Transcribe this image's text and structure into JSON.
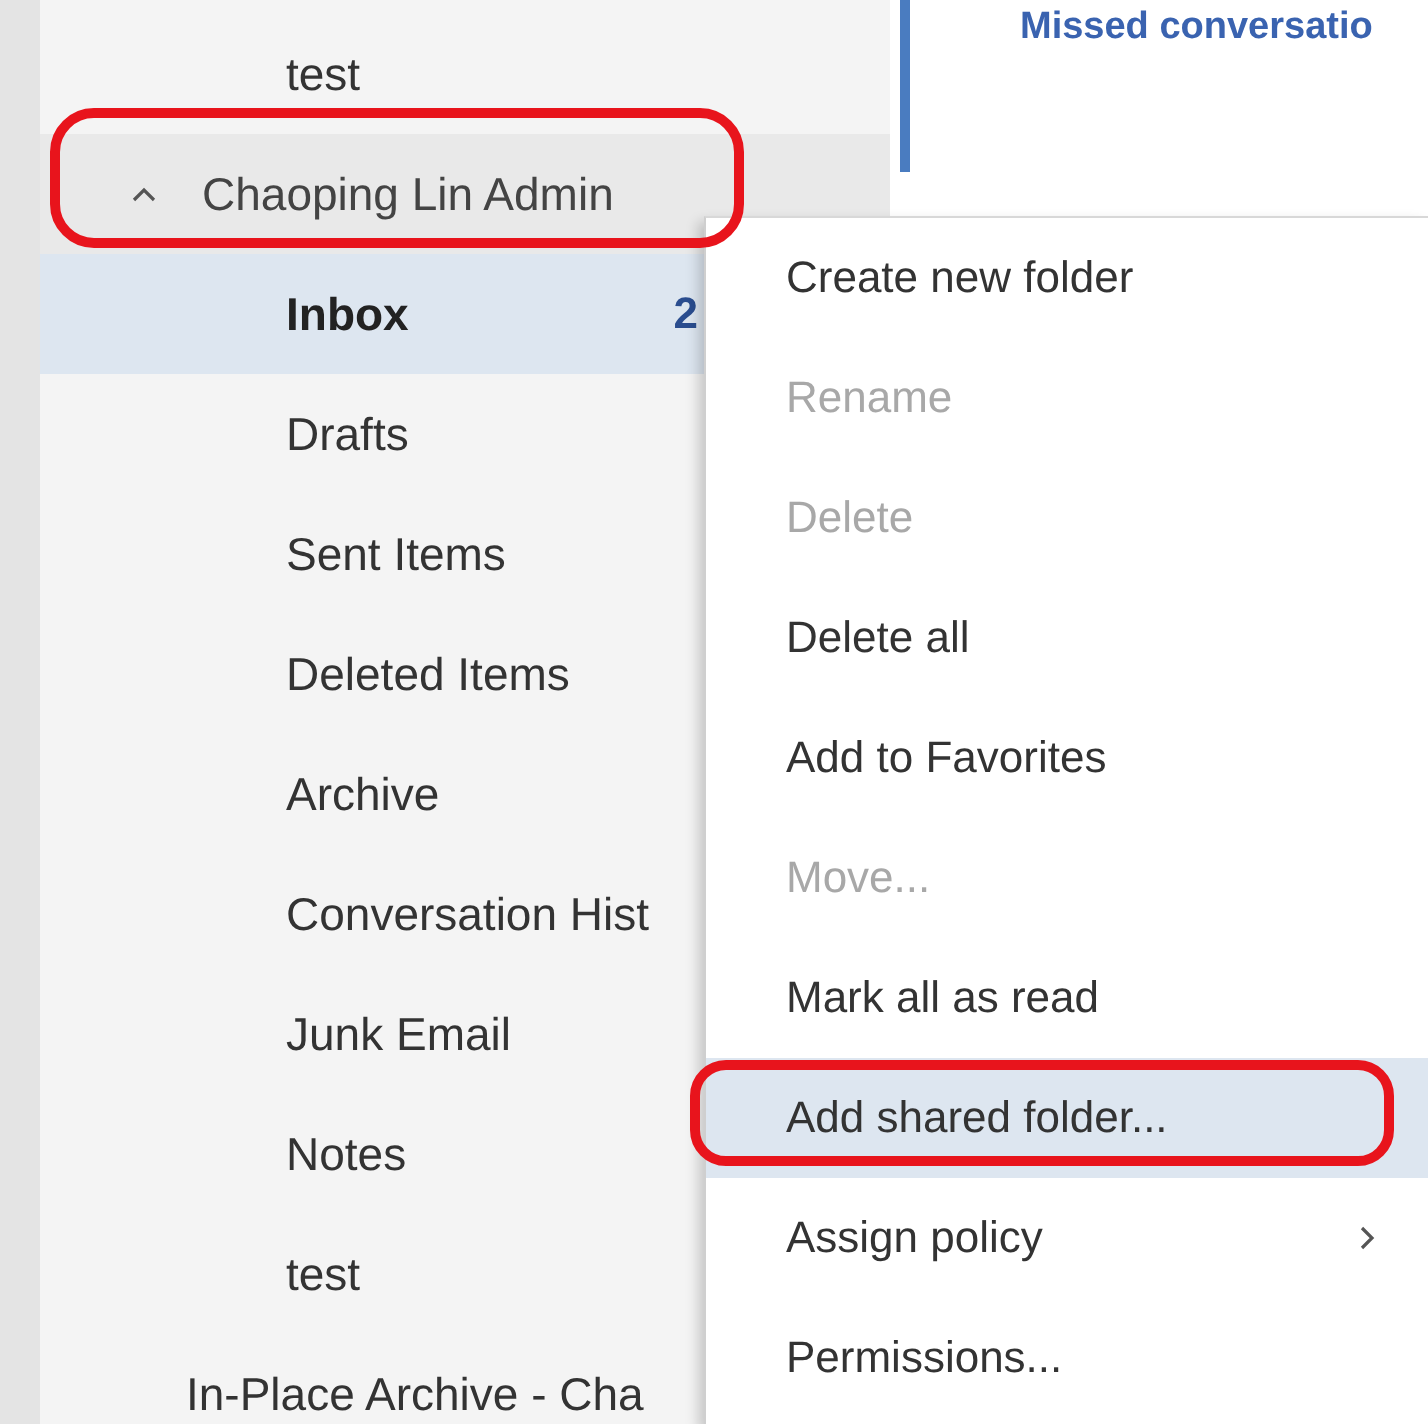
{
  "folders": [
    {
      "kind": "folder",
      "label": "test",
      "selected": false
    },
    {
      "kind": "account",
      "label": "Chaoping Lin Admin",
      "expanded": true,
      "annotated": true
    },
    {
      "kind": "folder",
      "label": "Inbox",
      "selected": true,
      "count": "2"
    },
    {
      "kind": "folder",
      "label": "Drafts",
      "selected": false
    },
    {
      "kind": "folder",
      "label": "Sent Items",
      "selected": false
    },
    {
      "kind": "folder",
      "label": "Deleted Items",
      "selected": false
    },
    {
      "kind": "folder",
      "label": "Archive",
      "selected": false
    },
    {
      "kind": "folder",
      "label": "Conversation Hist",
      "selected": false
    },
    {
      "kind": "folder",
      "label": "Junk Email",
      "selected": false
    },
    {
      "kind": "folder",
      "label": "Notes",
      "selected": false
    },
    {
      "kind": "folder",
      "label": "test",
      "selected": false
    },
    {
      "kind": "archive",
      "label": "In-Place Archive - Cha"
    }
  ],
  "message_preview": {
    "title": "Missed conversatio"
  },
  "context_menu": [
    {
      "label": "Create new folder",
      "disabled": false,
      "selected": false
    },
    {
      "label": "Rename",
      "disabled": true,
      "selected": false
    },
    {
      "label": "Delete",
      "disabled": true,
      "selected": false
    },
    {
      "label": "Delete all",
      "disabled": false,
      "selected": false
    },
    {
      "label": "Add to Favorites",
      "disabled": false,
      "selected": false
    },
    {
      "label": "Move...",
      "disabled": true,
      "selected": false
    },
    {
      "label": "Mark all as read",
      "disabled": false,
      "selected": false
    },
    {
      "label": "Add shared folder...",
      "disabled": false,
      "selected": true,
      "annotated": true
    },
    {
      "label": "Assign policy",
      "disabled": false,
      "selected": false,
      "submenu": true
    },
    {
      "label": "Permissions...",
      "disabled": false,
      "selected": false
    }
  ]
}
